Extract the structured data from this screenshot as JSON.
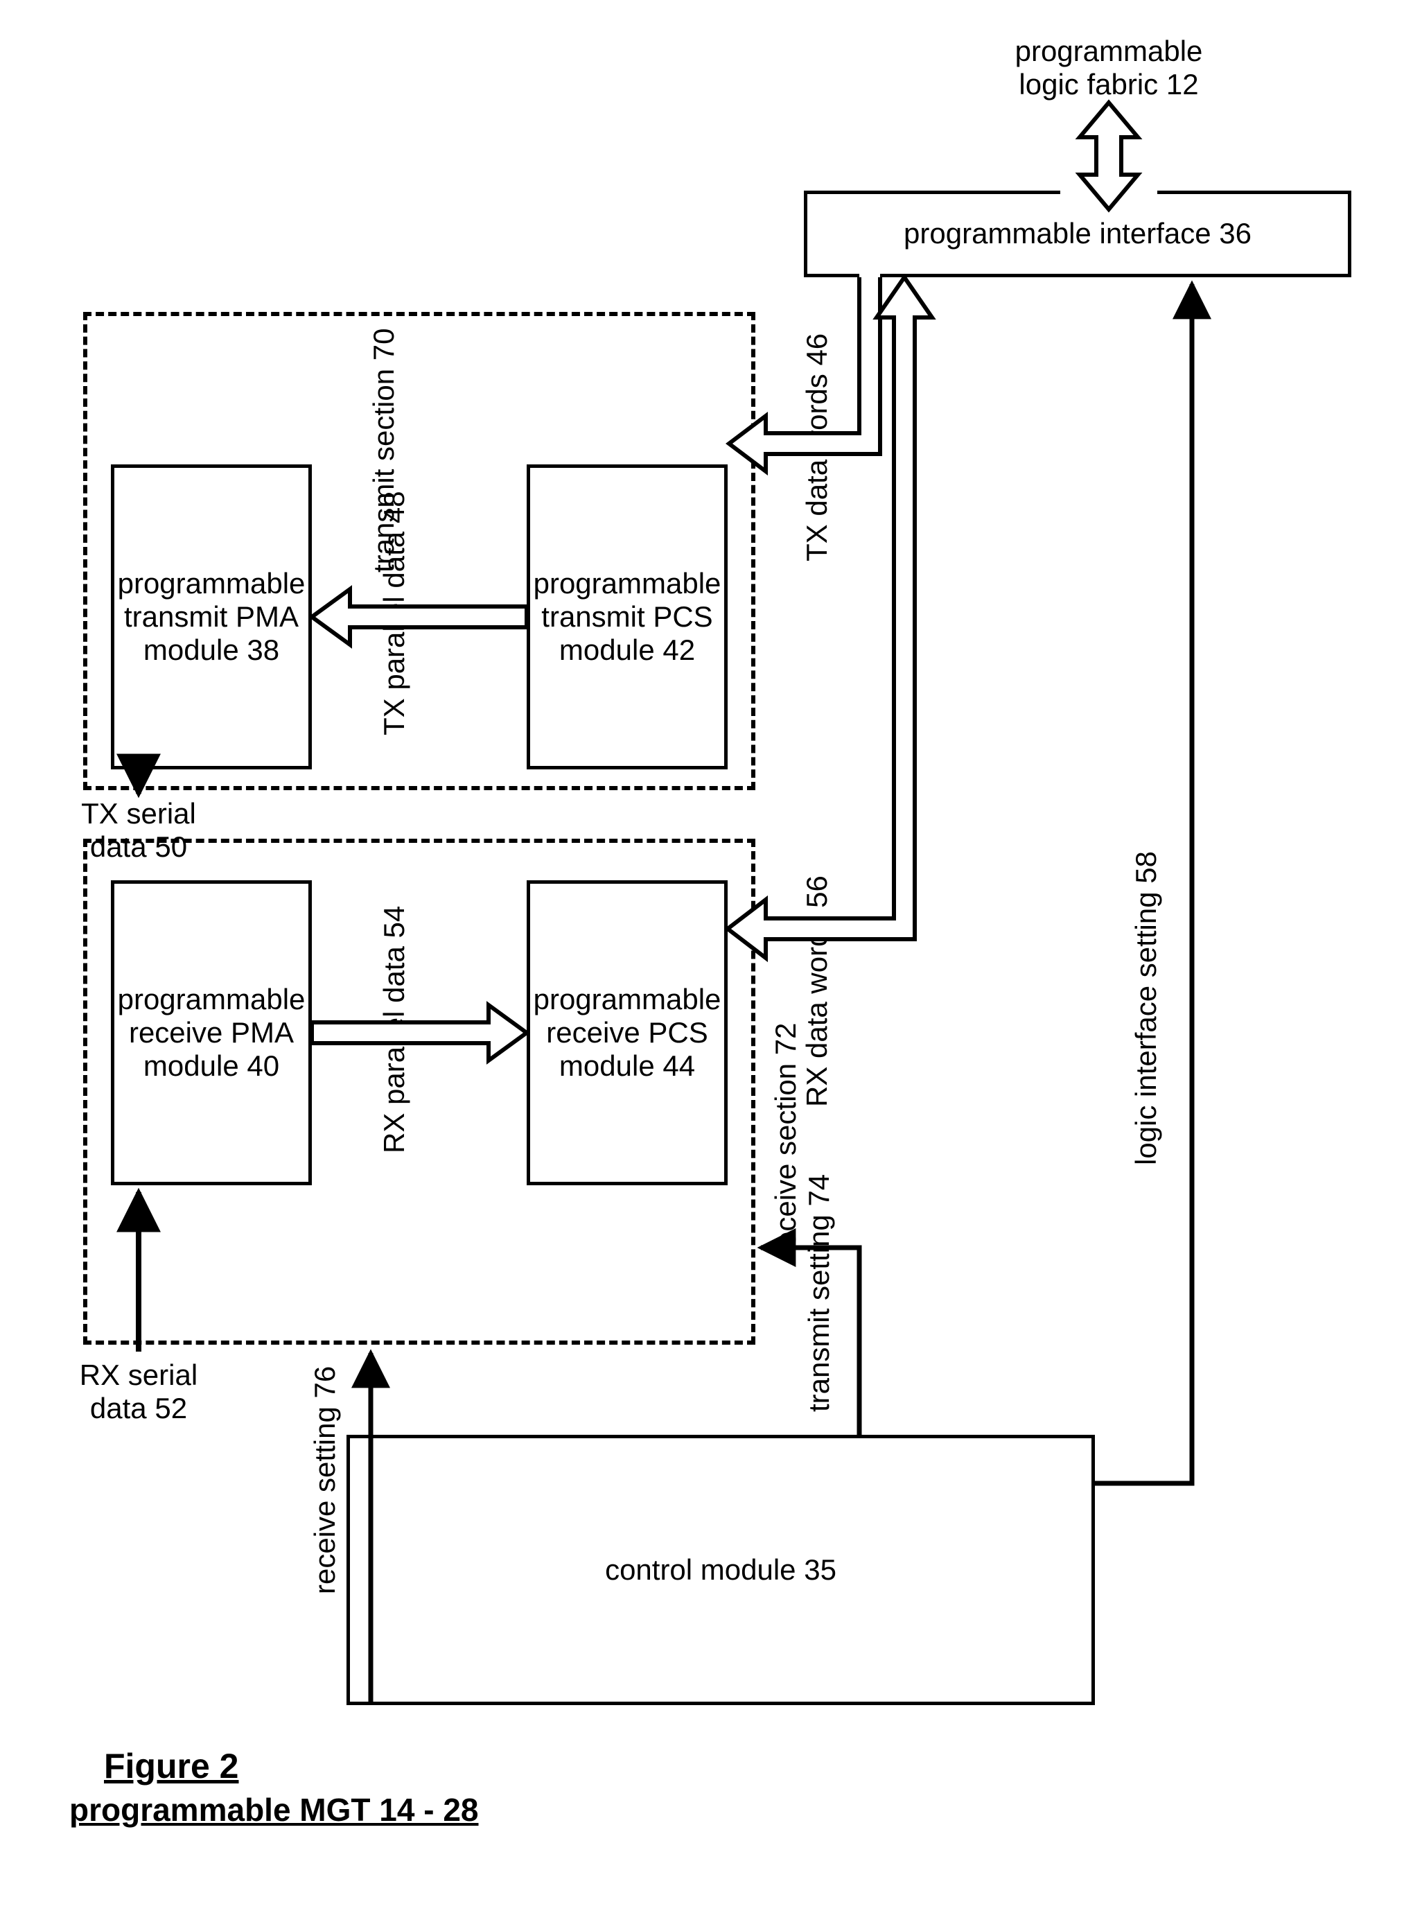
{
  "top_label": "programmable\nlogic fabric 12",
  "interface_box": "programmable interface 36",
  "tx_section_label": "transmit section 70",
  "rx_section_label": "receive section 72",
  "tx_pcs": "programmable\ntransmit PCS\nmodule 42",
  "tx_pma": "programmable\ntransmit PMA\nmodule 38",
  "rx_pcs": "programmable\nreceive PCS\nmodule 44",
  "rx_pma": "programmable\nreceive PMA\nmodule 40",
  "control_box": "control module 35",
  "tx_data_words": "TX data words 46",
  "rx_data_words": "RX data words 56",
  "tx_parallel": "TX parallel data 48",
  "rx_parallel": "RX parallel data 54",
  "tx_serial": "TX serial\ndata 50",
  "rx_serial": "RX serial\ndata 52",
  "logic_iface": "logic interface setting 58",
  "transmit_setting": "transmit setting 74",
  "receive_setting": "receive setting 76",
  "fig_num": "Figure 2",
  "fig_title": "programmable MGT 14 - 28"
}
